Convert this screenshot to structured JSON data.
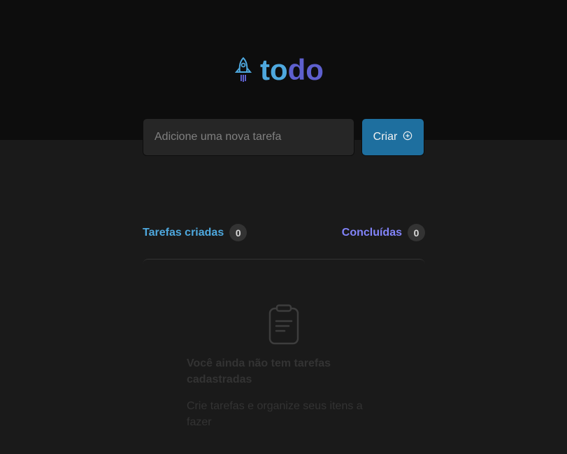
{
  "app": {
    "logo_part_1": "to",
    "logo_part_2": "do",
    "logo_icon": "rocket-icon"
  },
  "form": {
    "placeholder": "Adicione uma nova tarefa",
    "value": "",
    "create_label": "Criar",
    "create_icon": "plus-circle-icon"
  },
  "counters": {
    "created_label": "Tarefas criadas",
    "created_count": "0",
    "done_label": "Concluídas",
    "done_count": "0"
  },
  "empty_state": {
    "icon": "clipboard-icon",
    "title": "Você ainda não tem tarefas cadastradas",
    "subtitle": "Crie tarefas e organize seus itens a fazer"
  },
  "colors": {
    "header_bg": "#0d0d0d",
    "body_bg": "#1a1a1a",
    "blue": "#4ea8de",
    "purple": "#5e60ce",
    "purple_light": "#8284fa",
    "button": "#1e6f9f"
  }
}
